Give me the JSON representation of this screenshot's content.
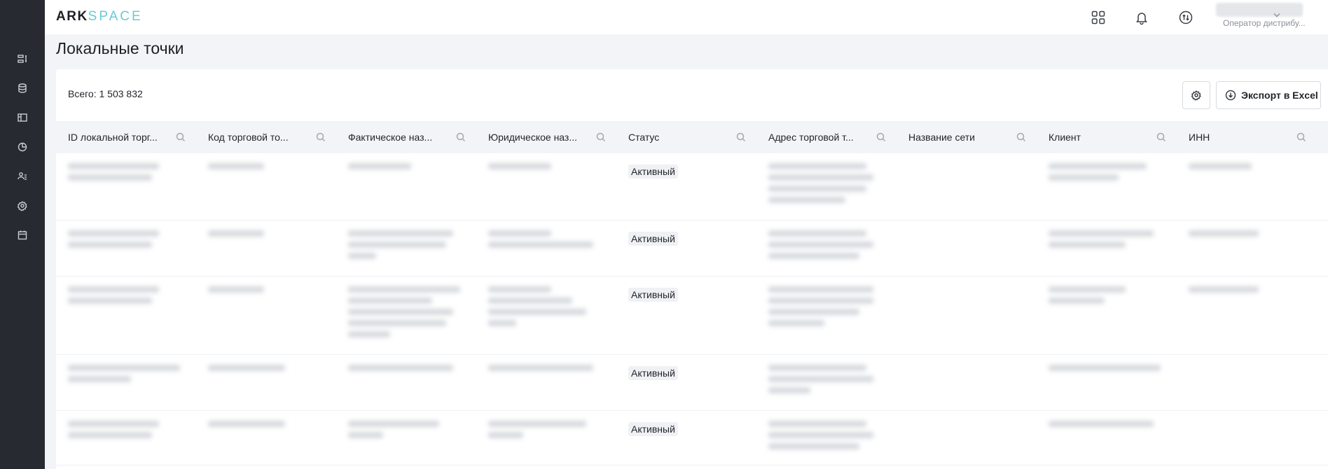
{
  "app": {
    "logo_ark": "ARK",
    "logo_space": "SPACE"
  },
  "sidebar": {
    "items": [
      {
        "name": "list-icon"
      },
      {
        "name": "database-icon"
      },
      {
        "name": "layout-icon"
      },
      {
        "name": "chart-pie-icon"
      },
      {
        "name": "users-icon"
      },
      {
        "name": "settings-icon"
      },
      {
        "name": "calendar-icon"
      }
    ]
  },
  "header": {
    "user_role": "Оператор дистрибу..."
  },
  "page": {
    "title": "Локальные точки",
    "total_label": "Всего: 1 503 832",
    "export_label": "Экспорт в Excel"
  },
  "table": {
    "columns": [
      {
        "label": "ID локальной торг..."
      },
      {
        "label": "Код торговой то..."
      },
      {
        "label": "Фактическое наз..."
      },
      {
        "label": "Юридическое наз..."
      },
      {
        "label": "Статус"
      },
      {
        "label": "Адрес торговой т..."
      },
      {
        "label": "Название сети"
      },
      {
        "label": "Клиент"
      },
      {
        "label": "ИНН"
      }
    ],
    "rows": [
      {
        "status": "Активный"
      },
      {
        "status": "Активный"
      },
      {
        "status": "Активный"
      },
      {
        "status": "Активный"
      },
      {
        "status": "Активный"
      }
    ]
  },
  "colors": {
    "sidebar_bg": "#272a30",
    "logo_accent": "#6bcad3",
    "page_bg": "#f3f4f7"
  }
}
